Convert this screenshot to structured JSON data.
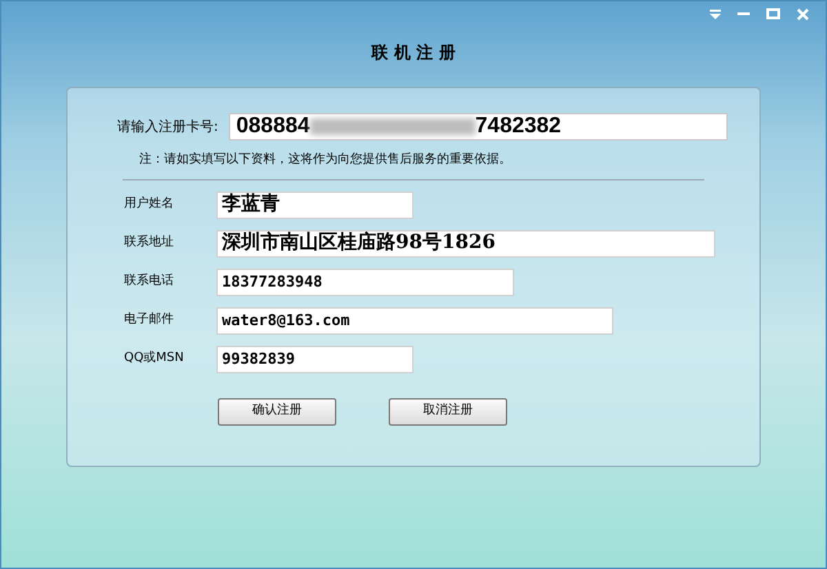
{
  "window": {
    "title": "联 机 注 册"
  },
  "card": {
    "label": "请输入注册卡号:",
    "value_start": "088884",
    "value_end": "7482382",
    "redacted": true
  },
  "note": "注：请如实填写以下资料，这将作为向您提供售后服务的重要依据。",
  "fields": [
    {
      "label": "用户姓名",
      "value": "李蓝青",
      "kind": "large"
    },
    {
      "label": "联系地址",
      "value": "深圳市南山区桂庙路98号1826",
      "kind": "large"
    },
    {
      "label": "联系电话",
      "value": "18377283948",
      "kind": "small"
    },
    {
      "label": "电子邮件",
      "value": "water8@163.com",
      "kind": "small"
    },
    {
      "label": "QQ或MSN",
      "value": "99382839",
      "kind": "small"
    }
  ],
  "buttons": [
    "确认注册",
    "取消注册"
  ]
}
